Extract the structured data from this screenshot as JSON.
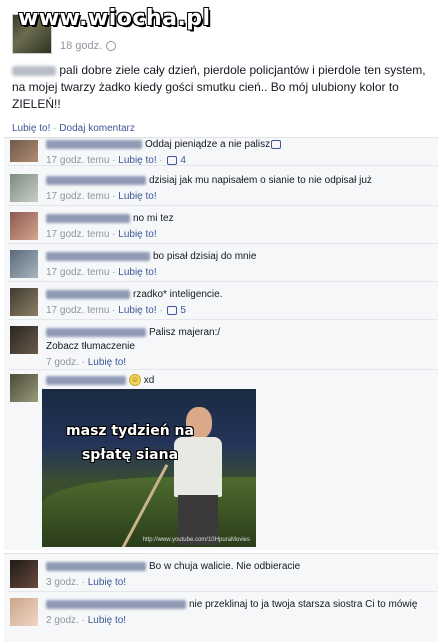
{
  "watermark": "www.wiocha.pl",
  "post": {
    "time": "18 godz.",
    "text": "pali dobre ziele cały dzień, pierdole policjantów i pierdole ten system, na mojej twarzy żadko kiedy gości smutku cień.. Bo mój ulubiony kolor to ZIELEŃ!!",
    "like_link": "Lubię to!",
    "separator": "·",
    "comment_link": "Dodaj komentarz"
  },
  "comments": [
    {
      "text": "Oddaj pieniądze a nie palisz",
      "time": "17 godz. temu",
      "like_link": "Lubię to!",
      "likes": "4"
    },
    {
      "text": "dzisiaj jak mu napisałem o sianie to nie odpisał już",
      "time": "17 godz. temu",
      "like_link": "Lubię to!",
      "likes": "1"
    },
    {
      "text": "no mi tez",
      "time": "17 godz. temu",
      "like_link": "Lubię to!",
      "likes": ""
    },
    {
      "text": "bo pisał dzisiaj do mnie",
      "time": "17 godz. temu",
      "like_link": "Lubię to!",
      "likes": ""
    },
    {
      "text": "rzadko* inteligencie.",
      "time": "17 godz. temu",
      "like_link": "Lubię to!",
      "likes": "5"
    },
    {
      "text": "Palisz majeran:/",
      "translate": "Zobacz tłumaczenie",
      "time": "7 godz.",
      "like_link": "Lubię to!",
      "likes": ""
    },
    {
      "text": "xd",
      "time": "",
      "like_link": "",
      "likes": ""
    },
    {
      "text": "Bo w chuja walicie. Nie odbieracie",
      "time": "3 godz.",
      "like_link": "Lubię to!",
      "likes": ""
    },
    {
      "text": "nie przeklinaj to ja twoja starsza siostra Ci to mówię",
      "time": "2 godz.",
      "like_link": "Lubię to!",
      "likes": ""
    }
  ],
  "meme": {
    "caption_line1": "masz tydzień na",
    "caption_line2": "spłatę siana",
    "url": "http://www.youtube.com/10HpuraMovies"
  }
}
